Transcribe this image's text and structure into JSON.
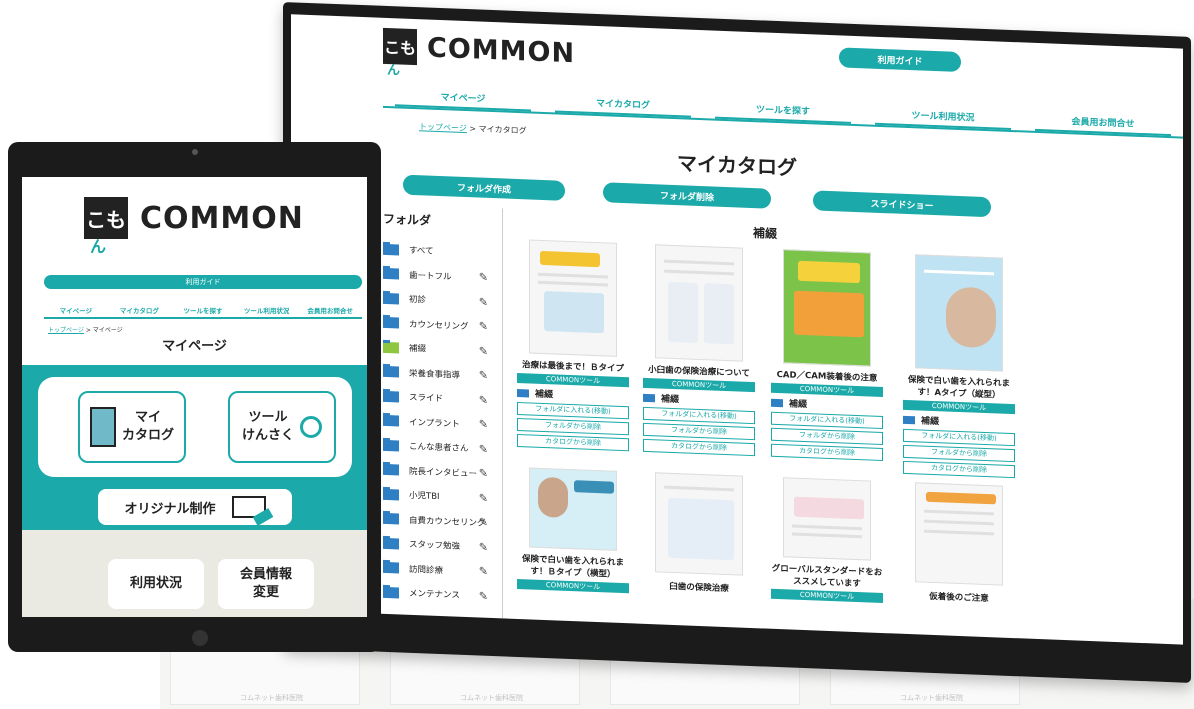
{
  "monitor": {
    "brand": "COMMON",
    "logo_mark": "こも",
    "guide_button": "利用ガイド",
    "nav": [
      "マイページ",
      "マイカタログ",
      "ツールを探す",
      "ツール利用状況",
      "会員用お問合せ"
    ],
    "breadcrumb_home": "トップページ",
    "breadcrumb_current": "マイカタログ",
    "page_title": "マイカタログ",
    "buttons": {
      "create_folder": "フォルダ作成",
      "delete_folder": "フォルダ削除",
      "slideshow": "スライドショー"
    },
    "sidebar_heading": "フォルダ",
    "folders": [
      "すべて",
      "歯ートフル",
      "初診",
      "カウンセリング",
      "補綴",
      "栄養食事指導",
      "スライド",
      "インプラント",
      "こんな患者さん",
      "院長インタビュー",
      "小児TBI",
      "自費カウンセリング",
      "スタッフ勉強",
      "訪問診療",
      "メンテナンス"
    ],
    "section_title": "補綴",
    "cards": [
      {
        "title": "治療は最後まで！Ｂタイプ",
        "tag": "COMMONツール",
        "folder": "補綴"
      },
      {
        "title": "小臼歯の保険治療について",
        "tag": "COMMONツール",
        "folder": "補綴"
      },
      {
        "title": "CAD／CAM装着後の注意",
        "tag": "COMMONツール",
        "folder": "補綴"
      },
      {
        "title": "保険で白い歯を入れられます！Aタイプ（縦型）",
        "tag": "COMMONツール",
        "folder": "補綴"
      },
      {
        "title": "保険で白い歯を入れられます！Ｂタイプ（横型）",
        "tag": "COMMONツール"
      },
      {
        "title": "臼歯の保険治療",
        "tag": ""
      },
      {
        "title": "グローバルスタンダードをおススメしています",
        "tag": "COMMONツール"
      },
      {
        "title": "仮着後のご注意",
        "tag": ""
      }
    ],
    "card_actions": [
      "フォルダに入れる(移動)",
      "フォルダから削除",
      "カタログから削除"
    ]
  },
  "tablet": {
    "brand": "COMMON",
    "logo_mark": "こも",
    "guide_button": "利用ガイド",
    "nav": [
      "マイページ",
      "マイカタログ",
      "ツールを探す",
      "ツール利用状況",
      "会員用お問合せ"
    ],
    "breadcrumb_home": "トップページ",
    "breadcrumb_current": "マイページ",
    "page_title": "マイページ",
    "my_catalog_line1": "マイ",
    "my_catalog_line2": "カタログ",
    "tool_search_line1": "ツール",
    "tool_search_line2": "けんさく",
    "original": "オリジナル制作",
    "usage": "利用状況",
    "member_line1": "会員情報",
    "member_line2": "変更"
  },
  "background": {
    "footer": "コムネット歯科医院"
  },
  "colors": {
    "accent": "#1ba9a9",
    "folder": "#2e7fc4"
  }
}
